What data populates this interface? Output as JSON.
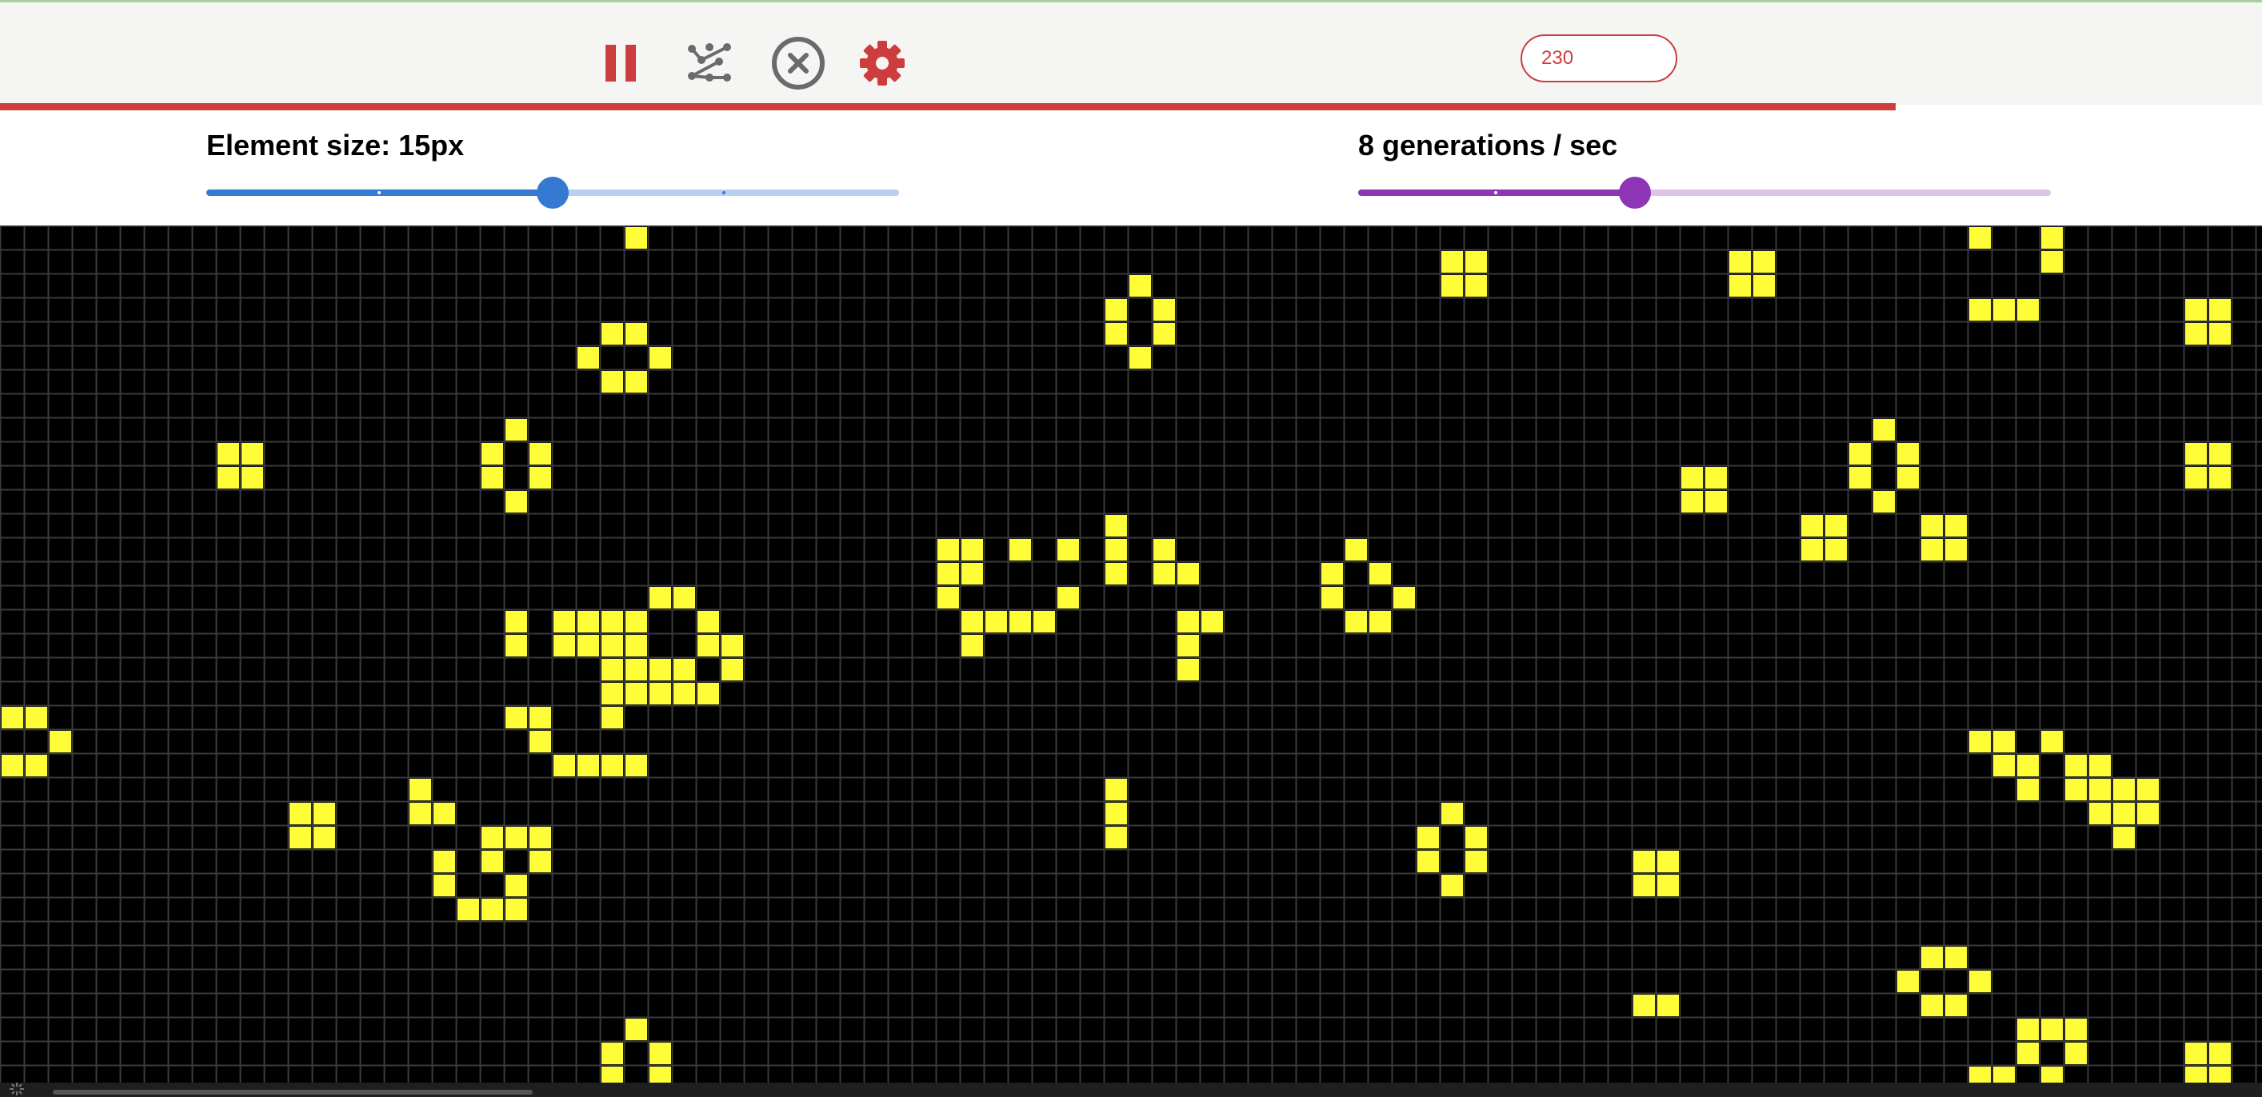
{
  "toolbar": {
    "buttons": [
      {
        "name": "pause-button",
        "icon": "pause-icon"
      },
      {
        "name": "randomize-button",
        "icon": "scatter-dots-icon"
      },
      {
        "name": "clear-button",
        "icon": "close-circle-icon"
      },
      {
        "name": "settings-button",
        "icon": "gear-icon"
      }
    ],
    "generation_count": "230",
    "generation_progress": 0.838
  },
  "element_size": {
    "label": "Element size: 15px",
    "value_fraction": 0.5
  },
  "speed": {
    "label": "8 generations / sec",
    "value_fraction": 0.4
  },
  "colors": {
    "accent_red": "#cd3d3d",
    "icon_gray": "#6b6b6b",
    "size_slider": "#3579d3",
    "size_slider_track": "#b8cfee",
    "speed_slider": "#8e35b5",
    "speed_slider_track": "#dcc3ea",
    "cell_alive": "#fffd38",
    "grid_line": "#3a3a3a",
    "board_bg": "#000000"
  },
  "board": {
    "cell_size_px": 15,
    "live_cells_note": "",
    "live_cells": [
      [
        26,
        0
      ],
      [
        25,
        4
      ],
      [
        26,
        4
      ],
      [
        24,
        5
      ],
      [
        27,
        5
      ],
      [
        25,
        6
      ],
      [
        26,
        6
      ],
      [
        9,
        9
      ],
      [
        10,
        9
      ],
      [
        9,
        10
      ],
      [
        10,
        10
      ],
      [
        21,
        8
      ],
      [
        20,
        9
      ],
      [
        22,
        9
      ],
      [
        20,
        10
      ],
      [
        22,
        10
      ],
      [
        21,
        11
      ],
      [
        27,
        15
      ],
      [
        28,
        15
      ],
      [
        26,
        16
      ],
      [
        29,
        16
      ],
      [
        21,
        16
      ],
      [
        24,
        16
      ],
      [
        25,
        16
      ],
      [
        23,
        16
      ],
      [
        21,
        17
      ],
      [
        23,
        17
      ],
      [
        24,
        17
      ],
      [
        25,
        18
      ],
      [
        26,
        18
      ],
      [
        27,
        18
      ],
      [
        28,
        18
      ],
      [
        29,
        17
      ],
      [
        30,
        17
      ],
      [
        25,
        17
      ],
      [
        26,
        17
      ],
      [
        25,
        19
      ],
      [
        26,
        19
      ],
      [
        27,
        19
      ],
      [
        28,
        19
      ],
      [
        29,
        19
      ],
      [
        30,
        18
      ],
      [
        25,
        20
      ],
      [
        21,
        20
      ],
      [
        22,
        20
      ],
      [
        22,
        21
      ],
      [
        23,
        22
      ],
      [
        24,
        22
      ],
      [
        25,
        22
      ],
      [
        26,
        22
      ],
      [
        0,
        20
      ],
      [
        1,
        20
      ],
      [
        2,
        21
      ],
      [
        0,
        22
      ],
      [
        1,
        22
      ],
      [
        12,
        24
      ],
      [
        13,
        24
      ],
      [
        12,
        25
      ],
      [
        13,
        25
      ],
      [
        17,
        23
      ],
      [
        17,
        24
      ],
      [
        18,
        24
      ],
      [
        18,
        26
      ],
      [
        18,
        27
      ],
      [
        20,
        25
      ],
      [
        21,
        25
      ],
      [
        22,
        25
      ],
      [
        20,
        26
      ],
      [
        22,
        26
      ],
      [
        21,
        27
      ],
      [
        19,
        28
      ],
      [
        20,
        28
      ],
      [
        21,
        28
      ],
      [
        26,
        33
      ],
      [
        25,
        34
      ],
      [
        27,
        34
      ],
      [
        25,
        35
      ],
      [
        27,
        35
      ],
      [
        47,
        2
      ],
      [
        46,
        3
      ],
      [
        48,
        3
      ],
      [
        46,
        4
      ],
      [
        48,
        4
      ],
      [
        47,
        5
      ],
      [
        39,
        13
      ],
      [
        40,
        13
      ],
      [
        42,
        13
      ],
      [
        44,
        13
      ],
      [
        46,
        12
      ],
      [
        39,
        14
      ],
      [
        40,
        14
      ],
      [
        44,
        15
      ],
      [
        46,
        14
      ],
      [
        48,
        13
      ],
      [
        48,
        14
      ],
      [
        49,
        14
      ],
      [
        39,
        15
      ],
      [
        40,
        16
      ],
      [
        41,
        16
      ],
      [
        42,
        16
      ],
      [
        43,
        16
      ],
      [
        44,
        15
      ],
      [
        40,
        17
      ],
      [
        50,
        16
      ],
      [
        49,
        16
      ],
      [
        49,
        17
      ],
      [
        49,
        18
      ],
      [
        46,
        13
      ],
      [
        46,
        14
      ],
      [
        46,
        23
      ],
      [
        46,
        24
      ],
      [
        46,
        25
      ],
      [
        56,
        13
      ],
      [
        55,
        14
      ],
      [
        57,
        14
      ],
      [
        55,
        15
      ],
      [
        58,
        15
      ],
      [
        56,
        16
      ],
      [
        57,
        16
      ],
      [
        60,
        1
      ],
      [
        61,
        1
      ],
      [
        60,
        2
      ],
      [
        61,
        2
      ],
      [
        60,
        24
      ],
      [
        59,
        25
      ],
      [
        61,
        25
      ],
      [
        59,
        26
      ],
      [
        61,
        26
      ],
      [
        60,
        27
      ],
      [
        68,
        26
      ],
      [
        69,
        26
      ],
      [
        68,
        27
      ],
      [
        69,
        27
      ],
      [
        68,
        32
      ],
      [
        69,
        32
      ],
      [
        72,
        1
      ],
      [
        73,
        1
      ],
      [
        72,
        2
      ],
      [
        73,
        2
      ],
      [
        70,
        10
      ],
      [
        71,
        10
      ],
      [
        70,
        11
      ],
      [
        71,
        11
      ],
      [
        75,
        12
      ],
      [
        76,
        12
      ],
      [
        75,
        13
      ],
      [
        76,
        13
      ],
      [
        80,
        12
      ],
      [
        81,
        12
      ],
      [
        80,
        13
      ],
      [
        81,
        13
      ],
      [
        78,
        8
      ],
      [
        77,
        9
      ],
      [
        79,
        9
      ],
      [
        77,
        10
      ],
      [
        79,
        10
      ],
      [
        78,
        11
      ],
      [
        82,
        0
      ],
      [
        85,
        0
      ],
      [
        85,
        1
      ],
      [
        82,
        3
      ],
      [
        83,
        3
      ],
      [
        84,
        3
      ],
      [
        91,
        3
      ],
      [
        92,
        3
      ],
      [
        91,
        4
      ],
      [
        92,
        4
      ],
      [
        91,
        9
      ],
      [
        92,
        9
      ],
      [
        91,
        10
      ],
      [
        92,
        10
      ],
      [
        82,
        21
      ],
      [
        83,
        21
      ],
      [
        85,
        21
      ],
      [
        83,
        22
      ],
      [
        84,
        22
      ],
      [
        86,
        22
      ],
      [
        84,
        23
      ],
      [
        87,
        22
      ],
      [
        88,
        23
      ],
      [
        87,
        23
      ],
      [
        86,
        23
      ],
      [
        89,
        23
      ],
      [
        88,
        24
      ],
      [
        89,
        24
      ],
      [
        88,
        25
      ],
      [
        87,
        24
      ],
      [
        80,
        30
      ],
      [
        81,
        30
      ],
      [
        79,
        31
      ],
      [
        82,
        31
      ],
      [
        80,
        32
      ],
      [
        81,
        32
      ],
      [
        84,
        33
      ],
      [
        85,
        33
      ],
      [
        86,
        33
      ],
      [
        84,
        34
      ],
      [
        86,
        34
      ],
      [
        82,
        35
      ],
      [
        83,
        35
      ],
      [
        85,
        35
      ],
      [
        91,
        34
      ],
      [
        92,
        34
      ],
      [
        91,
        35
      ],
      [
        92,
        35
      ]
    ]
  }
}
